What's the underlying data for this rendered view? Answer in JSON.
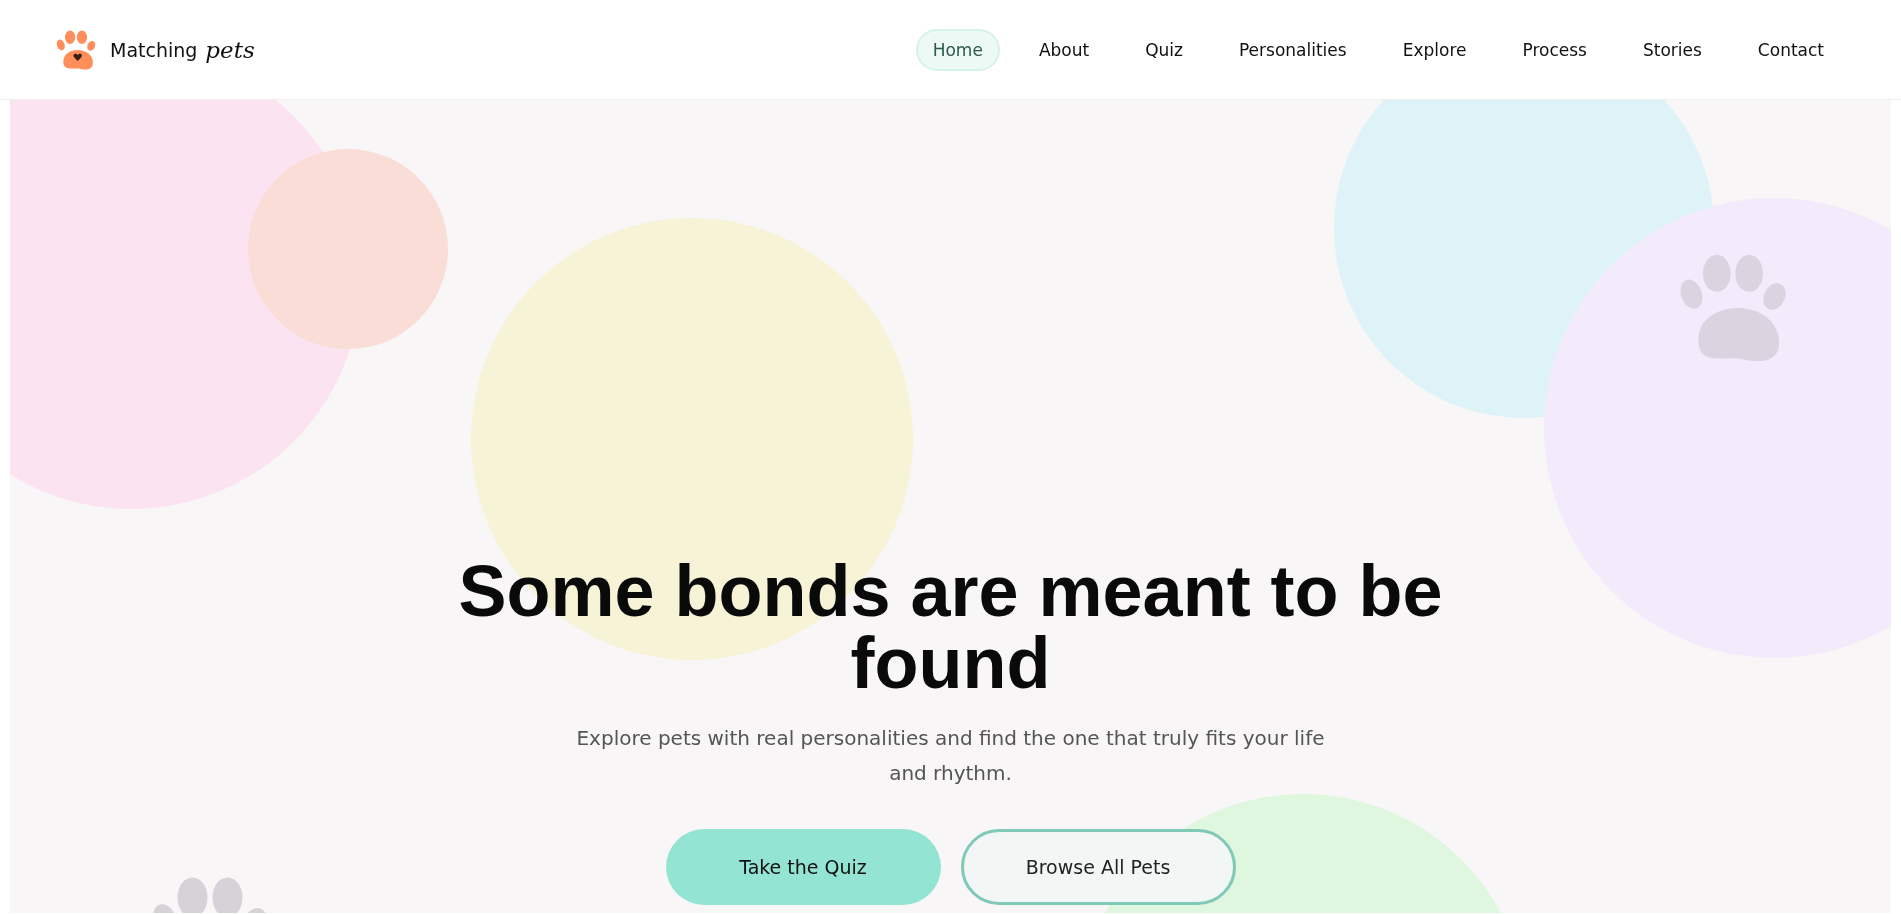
{
  "brand": {
    "name": "Matching",
    "accent": "pets"
  },
  "nav": [
    {
      "label": "Home",
      "selected": true
    },
    {
      "label": "About",
      "selected": false
    },
    {
      "label": "Quiz",
      "selected": false
    },
    {
      "label": "Personalities",
      "selected": false
    },
    {
      "label": "Explore",
      "selected": false
    },
    {
      "label": "Process",
      "selected": false
    },
    {
      "label": "Stories",
      "selected": false
    },
    {
      "label": "Contact",
      "selected": false
    }
  ],
  "hero": {
    "headline": "Some bonds are meant to be found",
    "subtitle": "Explore pets with real personalities and find the one that truly fits your life and rhythm.",
    "buttons": [
      {
        "label": "Take the Quiz",
        "kind": "primary"
      },
      {
        "label": "Browse All Pets",
        "kind": "secondary"
      }
    ]
  }
}
